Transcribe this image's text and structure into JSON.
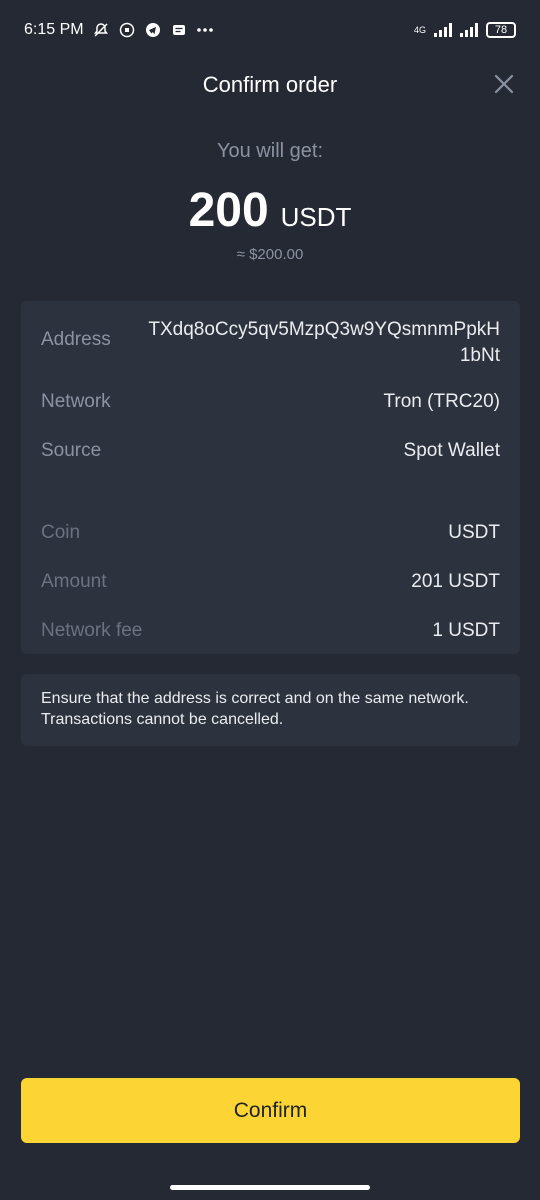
{
  "status_bar": {
    "time": "6:15 PM",
    "icons": [
      "mute-icon",
      "whatsapp-icon",
      "telegram-icon",
      "message-icon",
      "more-icon"
    ],
    "network": "4G",
    "battery": "78"
  },
  "header": {
    "title": "Confirm order",
    "close_icon": "close-icon"
  },
  "summary": {
    "you_will_get": "You will get:",
    "amount": "200",
    "unit": "USDT",
    "approx": "≈ $200.00"
  },
  "details": {
    "address_label": "Address",
    "address_value": "TXdq8oCcy5qv5MzpQ3w9YQsmnmPpkH1bNt",
    "network_label": "Network",
    "network_value": "Tron (TRC20)",
    "source_label": "Source",
    "source_value": "Spot Wallet",
    "coin_label": "Coin",
    "coin_value": "USDT",
    "amount_label": "Amount",
    "amount_value": "201 USDT",
    "fee_label": "Network fee",
    "fee_value": "1 USDT"
  },
  "notice": {
    "text": "Ensure that the address is correct and on the same network. Transactions cannot be cancelled."
  },
  "actions": {
    "confirm_label": "Confirm"
  },
  "colors": {
    "background": "#242933",
    "card": "#2c323e",
    "accent": "#fcd535",
    "muted_text": "#8b92a1"
  }
}
